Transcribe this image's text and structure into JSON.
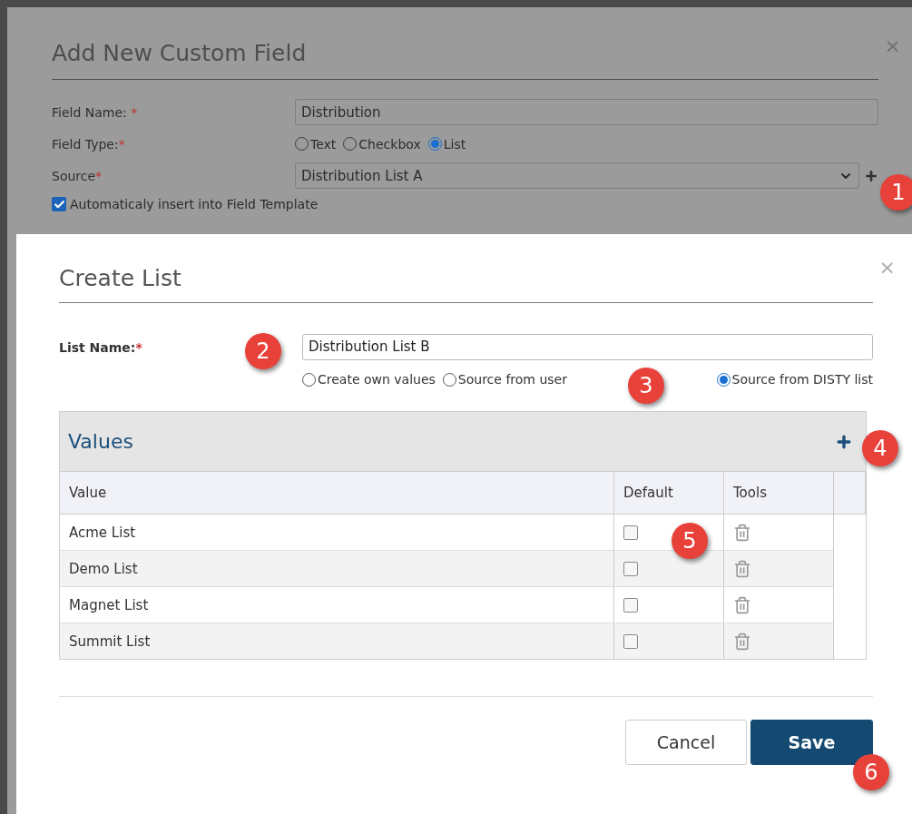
{
  "background_dialog": {
    "title": "Add New Custom Field",
    "close": "×",
    "field_name": {
      "label": "Field Name:",
      "required_mark": "*",
      "value": "Distribution"
    },
    "field_type": {
      "label": "Field Type:",
      "required_mark": "*",
      "options": [
        {
          "label": "Text",
          "selected": false
        },
        {
          "label": "Checkbox",
          "selected": false
        },
        {
          "label": "List",
          "selected": true
        }
      ]
    },
    "source": {
      "label": "Source",
      "required_mark": "*",
      "value": "Distribution List A"
    },
    "auto_insert": {
      "label": "Automaticaly insert into Field Template",
      "checked": true
    }
  },
  "create_list": {
    "title": "Create List",
    "close": "×",
    "list_name": {
      "label": "List Name:",
      "required_mark": "*",
      "value": "Distribution List B"
    },
    "source_options": [
      {
        "label": "Create own values",
        "selected": false
      },
      {
        "label": "Source from user",
        "selected": false
      },
      {
        "label": "Source from DISTY list",
        "selected": true
      }
    ],
    "values_panel": {
      "title": "Values",
      "columns": [
        "Value",
        "Default",
        "Tools"
      ],
      "rows": [
        {
          "value": "Acme List",
          "default": false
        },
        {
          "value": "Demo List",
          "default": false
        },
        {
          "value": "Magnet List",
          "default": false
        },
        {
          "value": "Summit List",
          "default": false
        }
      ]
    },
    "buttons": {
      "cancel": "Cancel",
      "save": "Save"
    }
  },
  "callouts": [
    "1",
    "2",
    "3",
    "4",
    "5",
    "6"
  ]
}
